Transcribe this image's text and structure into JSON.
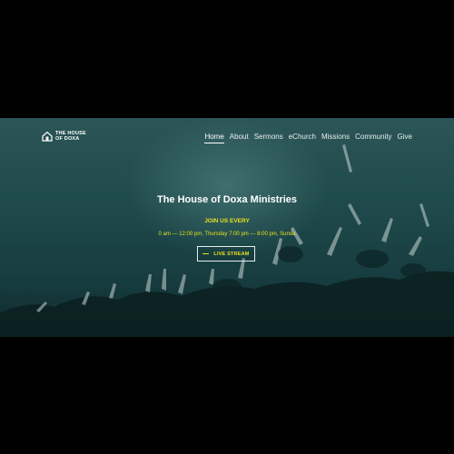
{
  "logo": {
    "text": "THE HOUSE OF DOXA",
    "icon": "house-icon"
  },
  "nav": {
    "items": [
      "Home",
      "About",
      "Sermons",
      "eChurch",
      "Missions",
      "Community",
      "Give"
    ],
    "active": "Home"
  },
  "hero": {
    "title": "The House of Doxa Ministries",
    "join": "JOIN US EVERY",
    "hours": "0 am — 12:00 pm, Thursday 7:00 pm — 8:00 pm, Sunda",
    "cta_label": "LIVE STREAM"
  },
  "colors": {
    "accent": "#e6e020",
    "text": "#ffffff",
    "hero_bg": "#1f4a4c",
    "frame": "#000000"
  }
}
